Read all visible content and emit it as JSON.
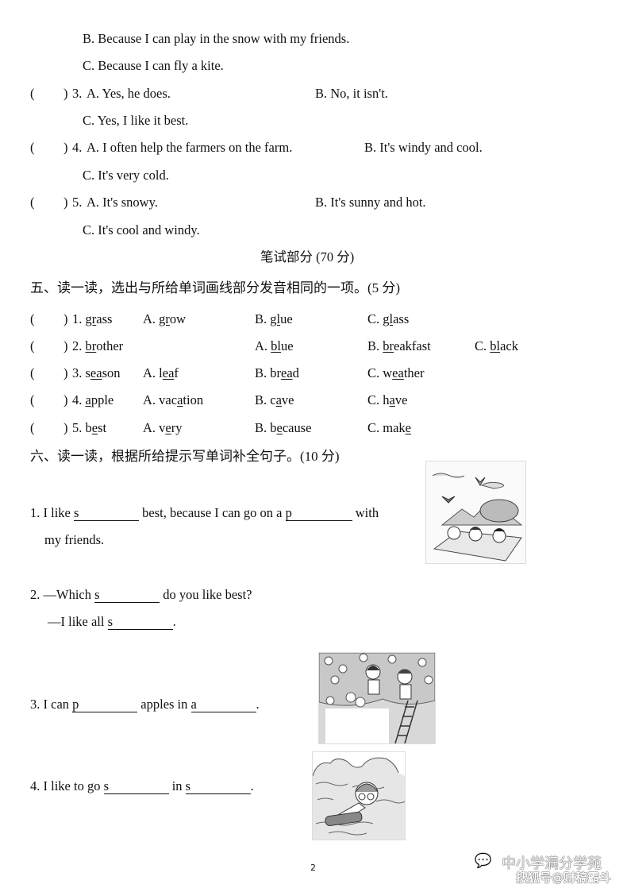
{
  "listening": {
    "q2_options": {
      "B": "B. Because I can play in the snow with my friends.",
      "C": "C. Because I can fly a kite."
    },
    "questions": [
      {
        "bracket_open": "(",
        "bracket_close": ")",
        "number": "3.",
        "A": "A. Yes, he does.",
        "B": "B. No, it isn't.",
        "C": "C. Yes, I like it best."
      },
      {
        "bracket_open": "(",
        "bracket_close": ")",
        "number": "4.",
        "A": "A. I often help the farmers on the farm.",
        "B": "B. It's windy and cool.",
        "C": "C. It's very cold."
      },
      {
        "bracket_open": "(",
        "bracket_close": ")",
        "number": "5.",
        "A": "A. It's snowy.",
        "B": "B. It's sunny and hot.",
        "C": "C. It's cool and windy."
      }
    ]
  },
  "written_header": "笔试部分 (70 分)",
  "section5": {
    "title": "五、读一读，选出与所给单词画线部分发音相同的一项。(5 分)",
    "items": [
      {
        "num": "1.",
        "word": [
          "",
          "gr",
          "ass"
        ],
        "A": [
          "A. ",
          "gr",
          "ow"
        ],
        "B": [
          "B. ",
          "gl",
          "ue"
        ],
        "C": [
          "C. ",
          "gl",
          "ass"
        ]
      },
      {
        "num": "2.",
        "word": [
          "",
          "br",
          "other"
        ],
        "A": [
          "A. ",
          "bl",
          "ue"
        ],
        "B": [
          "B. ",
          "br",
          "eakfast"
        ],
        "C": [
          "C. ",
          "bl",
          "ack"
        ]
      },
      {
        "num": "3.",
        "word": [
          "s",
          "ea",
          "son"
        ],
        "A": [
          "A. l",
          "ea",
          "f"
        ],
        "B": [
          "B. br",
          "ea",
          "d"
        ],
        "C": [
          "C. w",
          "ea",
          "ther"
        ]
      },
      {
        "num": "4.",
        "word": [
          "",
          "a",
          "pple"
        ],
        "A": [
          "A. vac",
          "a",
          "tion"
        ],
        "B": [
          "B. c",
          "a",
          "ve"
        ],
        "C": [
          "C. h",
          "a",
          "ve"
        ]
      },
      {
        "num": "5.",
        "word": [
          "b",
          "e",
          "st"
        ],
        "A": [
          "A. v",
          "e",
          "ry"
        ],
        "B": [
          "B. b",
          "e",
          "cause"
        ],
        "C": [
          "C. mak",
          "e",
          ""
        ]
      }
    ]
  },
  "section6": {
    "title": "六、读一读，根据所给提示写单词补全句子。(10 分)",
    "s1": {
      "pre": "1. I like ",
      "hint1": "s",
      "mid": " best, because I can go on a ",
      "hint2": "p",
      "post": " with",
      "line2": "my friends."
    },
    "s2": {
      "pre": "2. —Which ",
      "hint1": "s",
      "post": " do you like best?",
      "line2_pre": "—I like all ",
      "hint2": "s",
      "line2_post": "."
    },
    "s3": {
      "pre": "3. I can ",
      "hint1": "p",
      "mid": " apples in ",
      "hint2": "a",
      "post": "."
    },
    "s4": {
      "pre": "4. I like to go ",
      "hint1": "s",
      "mid": " in ",
      "hint2": "s",
      "post": "."
    },
    "images": {
      "picnic": "picnic-illustration",
      "apple_picking": "apple-picking-illustration",
      "swimming": "swimming-illustration"
    }
  },
  "page_number": "2",
  "watermark": {
    "line1": "中小学满分学苑",
    "line2": "搜狐号@财稿霸斗"
  }
}
